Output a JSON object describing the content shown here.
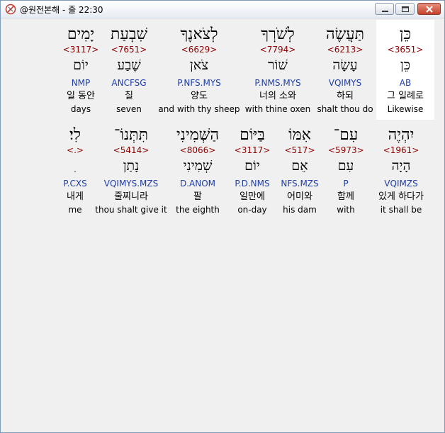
{
  "window": {
    "title": "@원전본해 - 줄 22:30"
  },
  "rows": [
    {
      "cells": [
        {
          "heb": "כֵּן",
          "strong": "<3651>",
          "heb2": "כֵּן",
          "morph": "AB",
          "kor": "그 일례로",
          "eng": "Likewise",
          "highlight": true
        },
        {
          "heb": "תַּעֲשֶׂה",
          "strong": "<6213>",
          "heb2": "עָשָׂה",
          "morph": "VQIMYS",
          "kor": "하되",
          "eng": "shalt thou do"
        },
        {
          "heb": "לְשֹׁרְךָ",
          "strong": "<7794>",
          "heb2": "שׁוֹר",
          "morph": "P.NMS.MYS",
          "kor": "너의 소와",
          "eng": "with thine oxen"
        },
        {
          "heb": "לְצֹאנֶךָ",
          "strong": "<6629>",
          "heb2": "צֹאן",
          "morph": "P.NFS.MYS",
          "kor": "양도",
          "eng": "and with thy sheep"
        },
        {
          "heb": "שִׁבְעַת",
          "strong": "<7651>",
          "heb2": "שֶׁבַע",
          "morph": "ANCFSG",
          "kor": "칠",
          "eng": "seven"
        },
        {
          "heb": "יָמִים",
          "strong": "<3117>",
          "heb2": "יוֹם",
          "morph": "NMP",
          "kor": "일 동안",
          "eng": "days"
        }
      ]
    },
    {
      "cells": [
        {
          "heb": "יִהְיֶה",
          "strong": "<1961>",
          "heb2": "הָיָה",
          "morph": "VQIMZS",
          "kor": "있게 하다가",
          "eng": "it shall be"
        },
        {
          "heb": "עִם־",
          "strong": "<5973>",
          "heb2": "עִם",
          "morph": "P",
          "kor": "함께",
          "eng": "with"
        },
        {
          "heb": "אִמּוֹ",
          "strong": "<517>",
          "heb2": "אֵם",
          "morph": "NFS.MZS",
          "kor": "어미와",
          "eng": "his dam"
        },
        {
          "heb": "בַּיּוֹם",
          "strong": "<3117>",
          "heb2": "יוֹם",
          "morph": "P.D.NMS",
          "kor": "일만에",
          "eng": "on-day"
        },
        {
          "heb": "הַשְּׁמִינִי",
          "strong": "<8066>",
          "heb2": "שְׁמִינִי",
          "morph": "D.ANOM",
          "kor": "팔",
          "eng": "the eighth"
        },
        {
          "heb": "תִּתְּנוֹ־",
          "strong": "<5414>",
          "heb2": "נָתַן",
          "morph": "VQIMYS.MZS",
          "kor": "줄찌니라",
          "eng": "thou shalt give it"
        },
        {
          "heb": "לִי׃",
          "strong": "<.>",
          "heb2": "ִ",
          "morph": "P.CXS",
          "kor": "내게",
          "eng": "me"
        }
      ]
    }
  ]
}
